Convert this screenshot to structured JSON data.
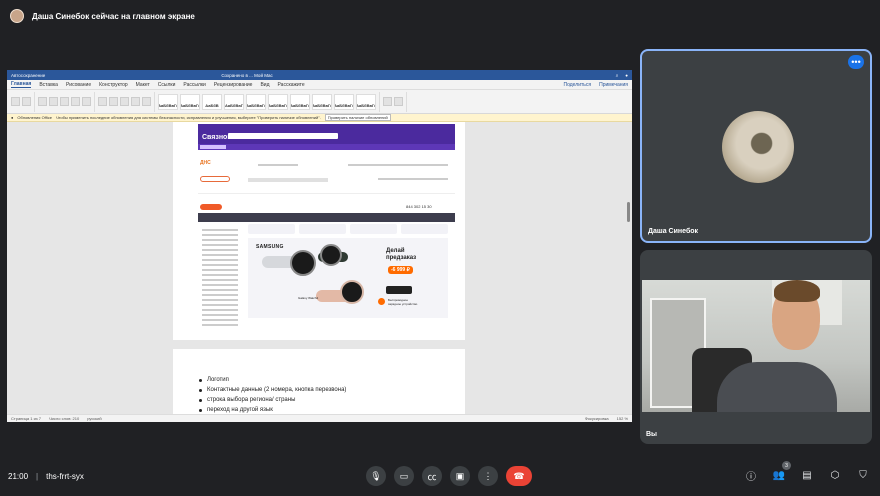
{
  "presenter": {
    "title": "Даша Синебок сейчас на главном экране"
  },
  "word": {
    "autosave": "Автосохранение",
    "doc_title": "Сохранено в ... Мой Mac",
    "tabs": [
      "Главная",
      "Вставка",
      "Рисование",
      "Конструктор",
      "Макет",
      "Ссылки",
      "Рассылки",
      "Рецензирование",
      "Вид",
      "Расскажите"
    ],
    "share": "Поделиться",
    "comments": "Примечания",
    "styles": [
      "АаБбВвГг",
      "АаБбВвГг",
      "АаБбВ",
      "АаБбВвГ",
      "АаБбВвГг",
      "АаБбВвГг",
      "АаБбВвГг",
      "АаБбВвГг",
      "АаБбВвГг",
      "АаБбВвГг"
    ],
    "notify_label": "Обновления Office",
    "notify_text": "Чтобы применить последние обновления для системы безопасности, исправления и улучшения, выберите \"Проверить наличие обновлений\".",
    "notify_btn": "Проверить наличие обновлений",
    "bullets": [
      "Логотип",
      "Контактные данные (2 номера, кнопка перезвона)",
      "строка выбора региона/ страны",
      "переход на другой язык"
    ],
    "status_page": "Страница 1 из 7",
    "status_words": "Число слов: 210",
    "status_lang": "русский",
    "status_focus": "Фокусировка",
    "status_zoom": "152 %"
  },
  "mockup": {
    "logo1": "Связной",
    "logo2": "ДНС",
    "phone": "844 302 15 30",
    "samsung": "SAMSUNG",
    "model": "Galaxy Watch4",
    "preorder": "Делай\nпредзаказ",
    "price": "-6 999 ₽",
    "gift": "Беспроводное\nзарядное устройство"
  },
  "tiles": {
    "person1": "Даша Синебок",
    "person2": "Вы"
  },
  "meeting": {
    "time": "21:00",
    "code": "ths-frrt-syx",
    "participants_count": "3"
  }
}
